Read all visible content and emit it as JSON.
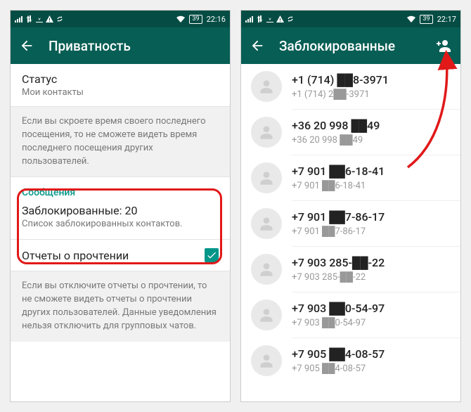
{
  "colors": {
    "brand": "#075E54",
    "brand_dark": "#054d44",
    "accent": "#009688",
    "grey_bg": "#f1f1f1"
  },
  "statusbar": {
    "left_icons": [
      "signal",
      "mobile-data",
      "download",
      "warning",
      "sync"
    ],
    "right_icons": [
      "wifi"
    ],
    "battery1": "39",
    "time1": "22:16",
    "battery2": "39",
    "time2": "22:17"
  },
  "privacy": {
    "appbar_title": "Приватность",
    "status_title": "Статус",
    "status_value": "Мои контакты",
    "last_seen_note": "Если вы скроете время своего последнего посещения, то не сможете видеть время последнего посещения других пользователей.",
    "messages_category": "Сообщения",
    "blocked_title": "Заблокированные: 20",
    "blocked_sub": "Список заблокированных контактов.",
    "read_receipts_title": "Отчеты о прочтении",
    "read_receipts_checked": true,
    "read_receipts_note": "Если вы отключите отчеты о прочтении, то не сможете видеть отчеты о прочтении других пользователей. Данные уведомления нельзя отключить для групповых чатов."
  },
  "blocked": {
    "appbar_title": "Заблокированные",
    "contacts": [
      {
        "primary": "+1 (714) ██8-3971",
        "secondary": "+1 (714) 2██-3971"
      },
      {
        "primary": "+36 20 998 ██49",
        "secondary": "+36 20 998 ██49"
      },
      {
        "primary": "+7 901 ██6-18-41",
        "secondary": "+7 901 ██6-18-41"
      },
      {
        "primary": "+7 901 ██7-86-17",
        "secondary": "+7 901 ██7-86-17"
      },
      {
        "primary": "+7 903 285-██-22",
        "secondary": "+7 903 285-██-22"
      },
      {
        "primary": "+7 903 ██0-54-97",
        "secondary": "+7 903 ██0-54-97"
      },
      {
        "primary": "+7 905 ██4-08-57",
        "secondary": "+7 905 ██4-08-57"
      }
    ]
  }
}
